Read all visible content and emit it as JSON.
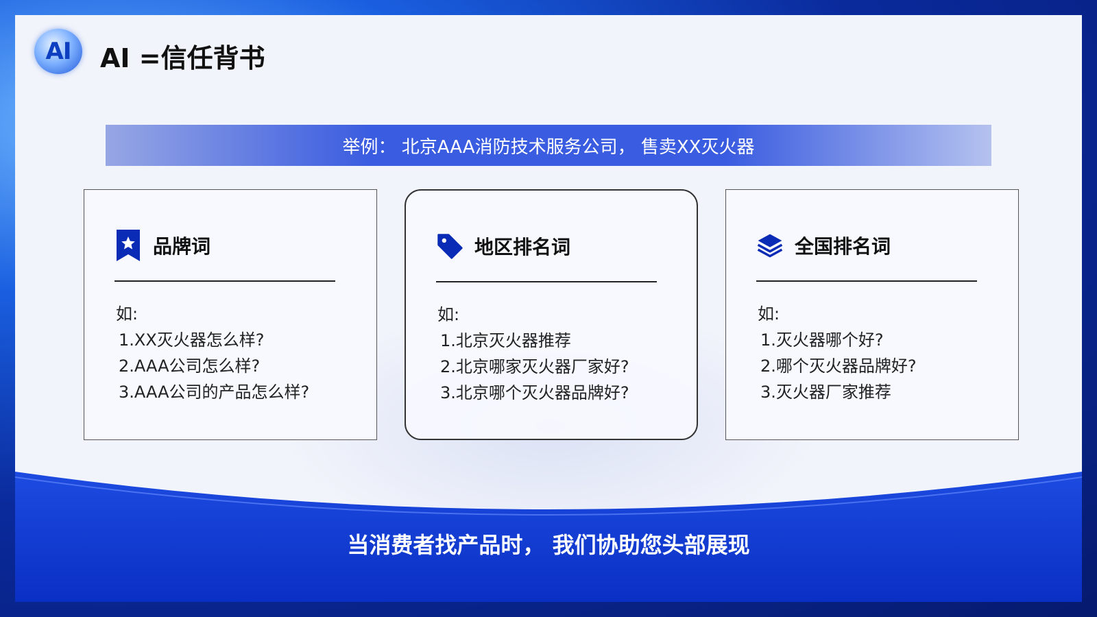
{
  "header": {
    "logo_text": "AI",
    "title": "AI =信任背书"
  },
  "example": {
    "text": "举例： 北京AAA消防技术服务公司， 售卖XX灭火器"
  },
  "cards": [
    {
      "icon": "bookmark-star-icon",
      "title": "品牌词",
      "intro": "如:",
      "items": [
        "1.XX灭火器怎么样?",
        "2.AAA公司怎么样?",
        "3.AAA公司的产品怎么样?"
      ]
    },
    {
      "icon": "tag-icon",
      "title": "地区排名词",
      "intro": "如:",
      "items": [
        "1.北京灭火器推荐",
        "2.北京哪家灭火器厂家好?",
        "3.北京哪个灭火器品牌好?"
      ]
    },
    {
      "icon": "layers-icon",
      "title": "全国排名词",
      "intro": "如:",
      "items": [
        "1.灭火器哪个好?",
        "2.哪个灭火器品牌好?",
        "3.灭火器厂家推荐"
      ]
    }
  ],
  "footer": {
    "slogan": "当消费者找产品时， 我们协助您头部展现"
  },
  "colors": {
    "brand_blue": "#0c34c8",
    "accent_icon": "#0a2bb5"
  }
}
